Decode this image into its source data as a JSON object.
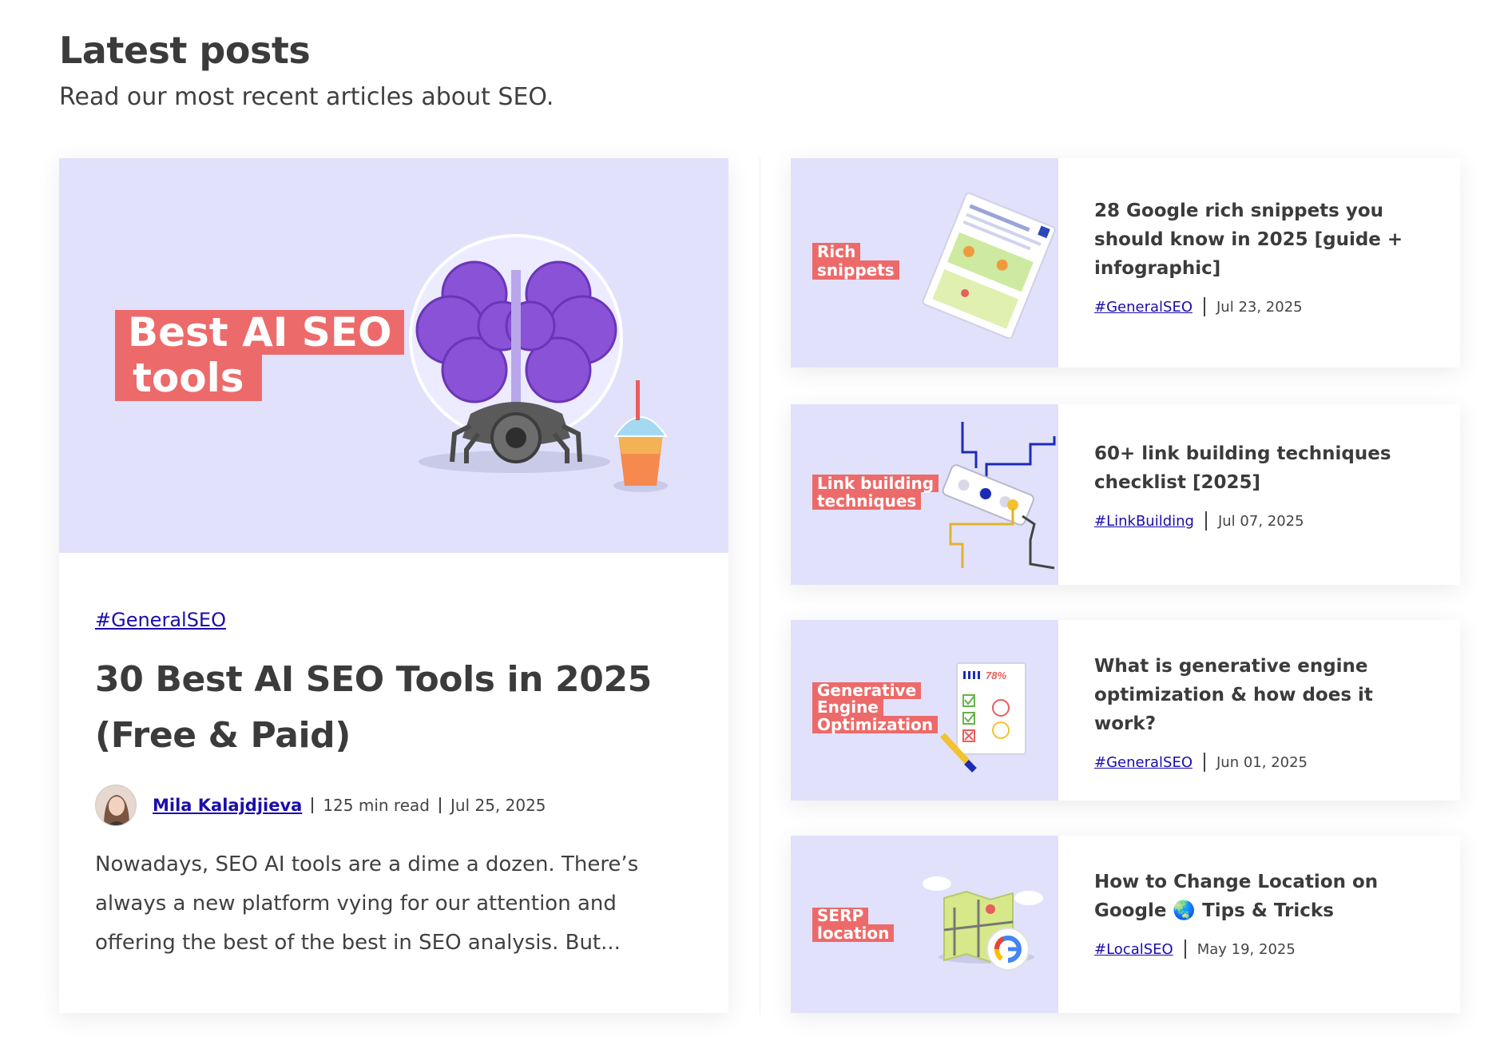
{
  "header": {
    "title": "Latest posts",
    "subtitle": "Read our most recent articles about SEO."
  },
  "featured": {
    "image_label_lines": [
      "Best AI SEO",
      "tools"
    ],
    "tag": "#GeneralSEO",
    "title": "30 Best AI SEO Tools in 2025 (Free & Paid)",
    "author": "Mila Kalajdjieva",
    "read_time": "125 min read",
    "date": "Jul 25, 2025",
    "excerpt": "Nowadays, SEO AI tools are a dime a dozen.  There’s always a new platform vying for our attention and offering the best of the best in SEO analysis.   But..."
  },
  "posts": [
    {
      "image_label_lines": [
        "Rich",
        "snippets"
      ],
      "title": "28 Google rich snippets you should know in 2025 [guide + infographic]",
      "tag": "#GeneralSEO",
      "date": "Jul 23, 2025"
    },
    {
      "image_label_lines": [
        "Link building",
        "techniques"
      ],
      "title": "60+ link building techniques checklist [2025]",
      "tag": "#LinkBuilding",
      "date": "Jul 07, 2025"
    },
    {
      "image_label_lines": [
        "Generative",
        "Engine",
        "Optimization"
      ],
      "title": "What is generative engine optimization & how does it work?",
      "tag": "#GeneralSEO",
      "date": "Jun 01, 2025",
      "image_percent": "78%"
    },
    {
      "image_label_lines": [
        "SERP",
        "location"
      ],
      "title": "How to Change Location on Google 🌏 Tips & Tricks",
      "tag": "#LocalSEO",
      "date": "May 19, 2025"
    }
  ],
  "colors": {
    "thumb_bg": "#e1e1fc",
    "label_red": "#ed6a6a",
    "link_blue": "#1a0dab",
    "brain_purple": "#8a52d6"
  }
}
